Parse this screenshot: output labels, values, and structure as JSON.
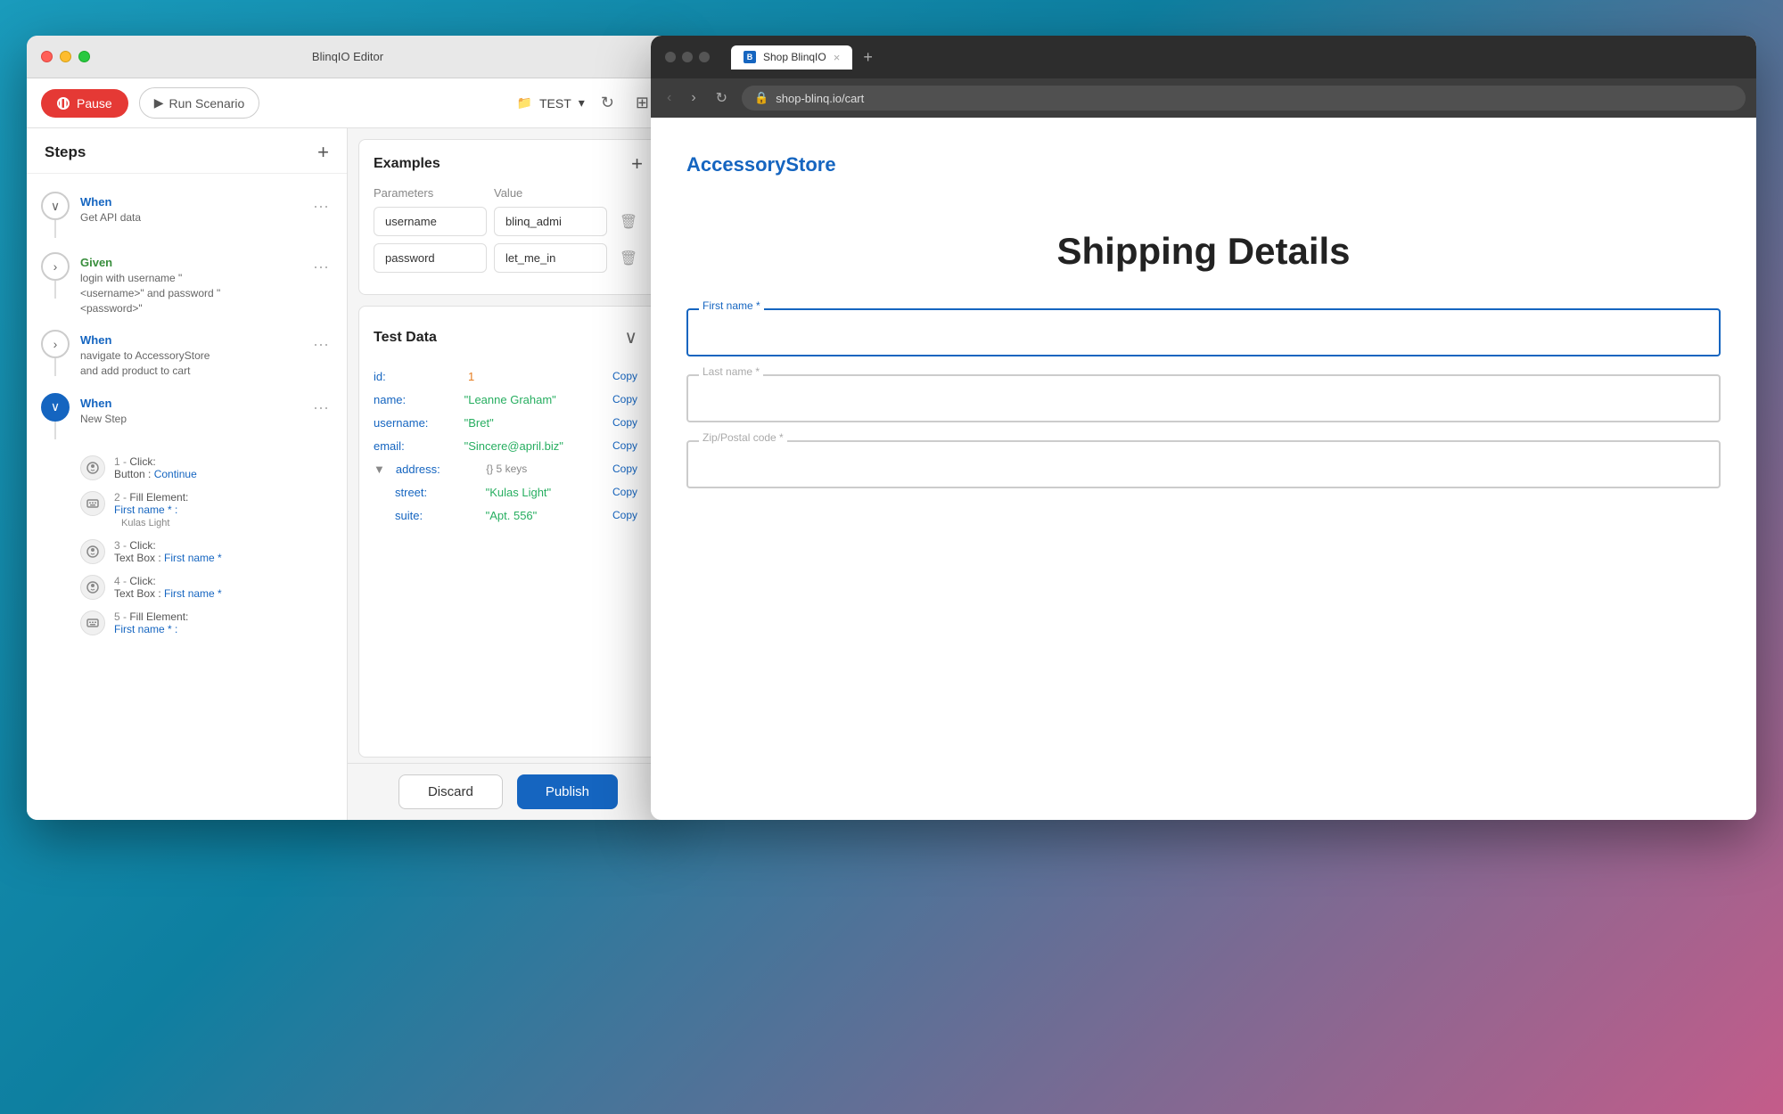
{
  "desktop": {
    "background": "gradient"
  },
  "editorWindow": {
    "title": "BlinqIO Editor",
    "toolbar": {
      "pause_label": "Pause",
      "run_label": "Run Scenario",
      "folder_label": "TEST"
    },
    "steps": {
      "header": "Steps",
      "items": [
        {
          "id": "step-1",
          "type": "When",
          "description": "Get API data",
          "expanded": true
        },
        {
          "id": "step-2",
          "type": "Given",
          "description": "login with username \"<username>\" and password \"<password>\"",
          "expanded": false
        },
        {
          "id": "step-3",
          "type": "When",
          "description": "navigate to AccessoryStore and add product to cart",
          "expanded": false
        },
        {
          "id": "step-4",
          "type": "When",
          "description": "New Step",
          "expanded": true,
          "active": true
        }
      ],
      "subSteps": [
        {
          "number": "1",
          "action": "Click:",
          "detail": "Button : Continue"
        },
        {
          "number": "2",
          "action": "Fill Element:",
          "detail": "First name * :",
          "subDetail": "Kulas Light"
        },
        {
          "number": "3",
          "action": "Click:",
          "detail": "Text Box : First name *"
        },
        {
          "number": "4",
          "action": "Click:",
          "detail": "Text Box : First name *"
        },
        {
          "number": "5",
          "action": "Fill Element:",
          "detail": "First name * :"
        }
      ]
    },
    "examples": {
      "title": "Examples",
      "columns": {
        "param": "Parameters",
        "value": "Value"
      },
      "rows": [
        {
          "parameter": "username",
          "value": "blinq_admi"
        },
        {
          "parameter": "password",
          "value": "let_me_in"
        }
      ]
    },
    "testData": {
      "title": "Test Data",
      "rows": [
        {
          "key": "id:",
          "value": "1",
          "type": "number"
        },
        {
          "key": "name:",
          "value": "\"Leanne Graham\"",
          "type": "string"
        },
        {
          "key": "username:",
          "value": "\"Bret\"",
          "type": "string"
        },
        {
          "key": "email:",
          "value": "\"Sincere@april.biz\"",
          "type": "string"
        },
        {
          "key": "address:",
          "value": "{}",
          "extra": "5 keys",
          "type": "object"
        },
        {
          "key": "street:",
          "value": "\"Kulas Light\"",
          "type": "string",
          "nested": true
        },
        {
          "key": "suite:",
          "value": "\"Apt. 556\"",
          "type": "string",
          "nested": true
        }
      ]
    },
    "buttons": {
      "discard": "Discard",
      "publish": "Publish"
    }
  },
  "browserWindow": {
    "title": "Shop BlinqIO",
    "address": "shop-blinq.io/cart",
    "content": {
      "storeName": "AccessoryStore",
      "storeNameColored": "Store",
      "pageTitle": "Shipping Details",
      "fields": [
        {
          "label": "First name *",
          "placeholder": "",
          "active": true
        },
        {
          "label": "Last name *",
          "placeholder": "",
          "active": false
        },
        {
          "label": "Zip/Postal code *",
          "placeholder": "",
          "active": false
        }
      ]
    }
  }
}
